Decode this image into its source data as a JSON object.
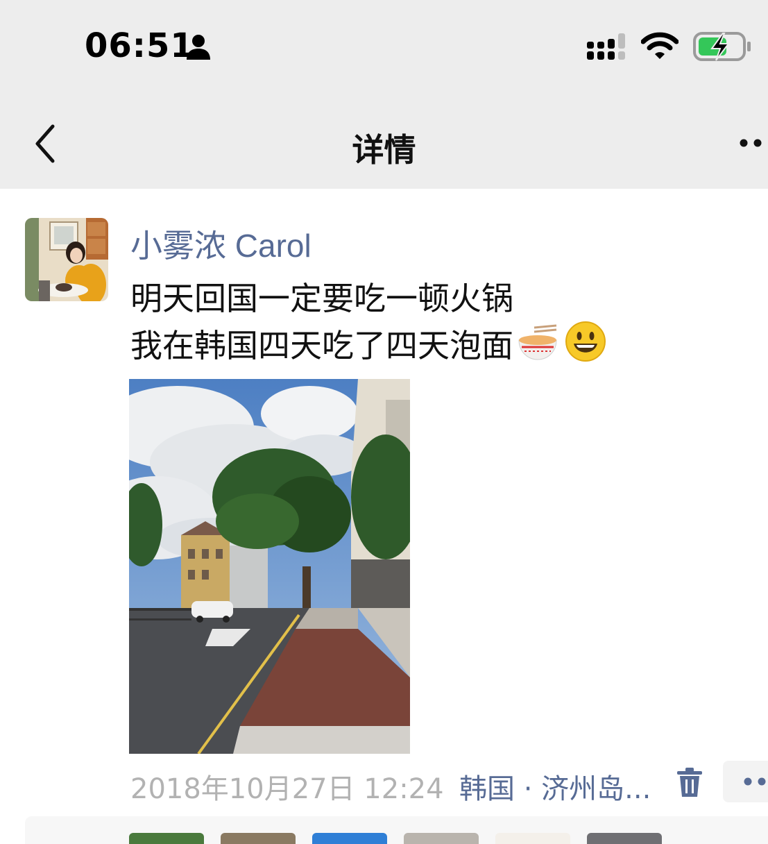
{
  "status_bar": {
    "time": "06:51"
  },
  "nav": {
    "title": "详情"
  },
  "post": {
    "author": "小雾浓 Carol",
    "lines": [
      "明天回国一定要吃一顿火锅",
      "我在韩国四天吃了四天泡面"
    ],
    "emojis": [
      "noodle-bowl-emoji",
      "smiley-emoji"
    ],
    "timestamp": "2018年10月27日 12:24",
    "location": "韩国 · 济州岛..."
  },
  "colors": {
    "link_blue": "#576b95",
    "meta_gray": "#b2b2b2",
    "bar_gray": "#ededed",
    "battery_green": "#34c759"
  }
}
